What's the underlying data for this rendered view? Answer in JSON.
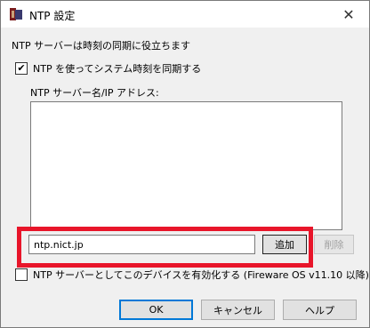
{
  "window": {
    "title": "NTP 設定",
    "close_symbol": "✕"
  },
  "description": "NTP サーバーは時刻の同期に役立ちます",
  "use_ntp": {
    "checked": true,
    "check_mark": "✔",
    "label": "NTP を使ってシステム時刻を同期する"
  },
  "server_section": {
    "label": "NTP サーバー名/IP アドレス:",
    "items": []
  },
  "server_input": {
    "value": "ntp.nict.jp"
  },
  "buttons": {
    "add": "追加",
    "remove": "削除",
    "ok": "OK",
    "cancel": "キャンセル",
    "help": "ヘルプ"
  },
  "enable_server": {
    "checked": false,
    "label": "NTP サーバーとしてこのデバイスを有効化する (Fireware OS v11.10 以降)"
  },
  "colors": {
    "highlight": "#e8152a",
    "focus": "#0078d7"
  },
  "icons": {
    "app": "fireware-app-icon"
  }
}
